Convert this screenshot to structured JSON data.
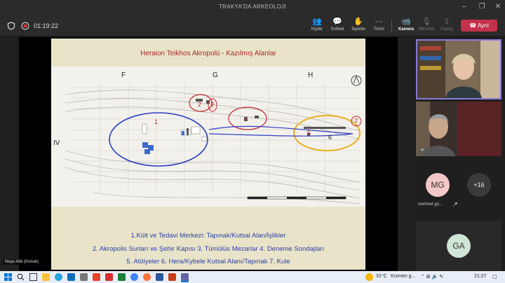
{
  "window": {
    "title": "TRAKYA'DA ARKEOLOJİ"
  },
  "toolbar": {
    "timer": "01:19:22",
    "people": "Kişiler",
    "chat": "Sohbet",
    "reactions": "Tepkiler",
    "more": "Tümü",
    "camera": "Kamera",
    "mic": "Mikrofon",
    "share": "Paylaş",
    "leave": "Ayrıl"
  },
  "slide": {
    "title": "Heraion Teikhos Akropolü  - Kazılmış Alanlar",
    "column_labels": [
      "F",
      "G",
      "H"
    ],
    "row_label": "IV",
    "area_numbers": [
      "1",
      "2",
      "3",
      "4",
      "5",
      "6",
      "7"
    ],
    "legend": [
      "1.Kült  ve Tedavi Merkezi: Tapınak/Kutsal Alan/İşlikler",
      "2. Akropolis Surları ve Şehir Kapısı  3. Tümülüs Mezarlar   4. Deneme Sondajları",
      "5. Atölyeler  6. Hera/Kybele Kutsal Alanı/Tapınak 7. Kule"
    ]
  },
  "presenter_label": "Neşe Atik (Konuk)",
  "participants": {
    "initials_1": "MG",
    "name_1": "mehmet gü...",
    "overflow": "+16",
    "initials_2": "GA"
  },
  "taskbar": {
    "temperature": "31°C",
    "weather": "Kısmen g...",
    "time": "21:27"
  },
  "colors": {
    "accent_leave": "#c4314b",
    "slide_title": "#a8262a",
    "legend_text": "#2a3ea8",
    "ellipse_blue": "#2e3fc2",
    "ellipse_red": "#c0262a",
    "ellipse_yellow": "#e6b21e"
  }
}
